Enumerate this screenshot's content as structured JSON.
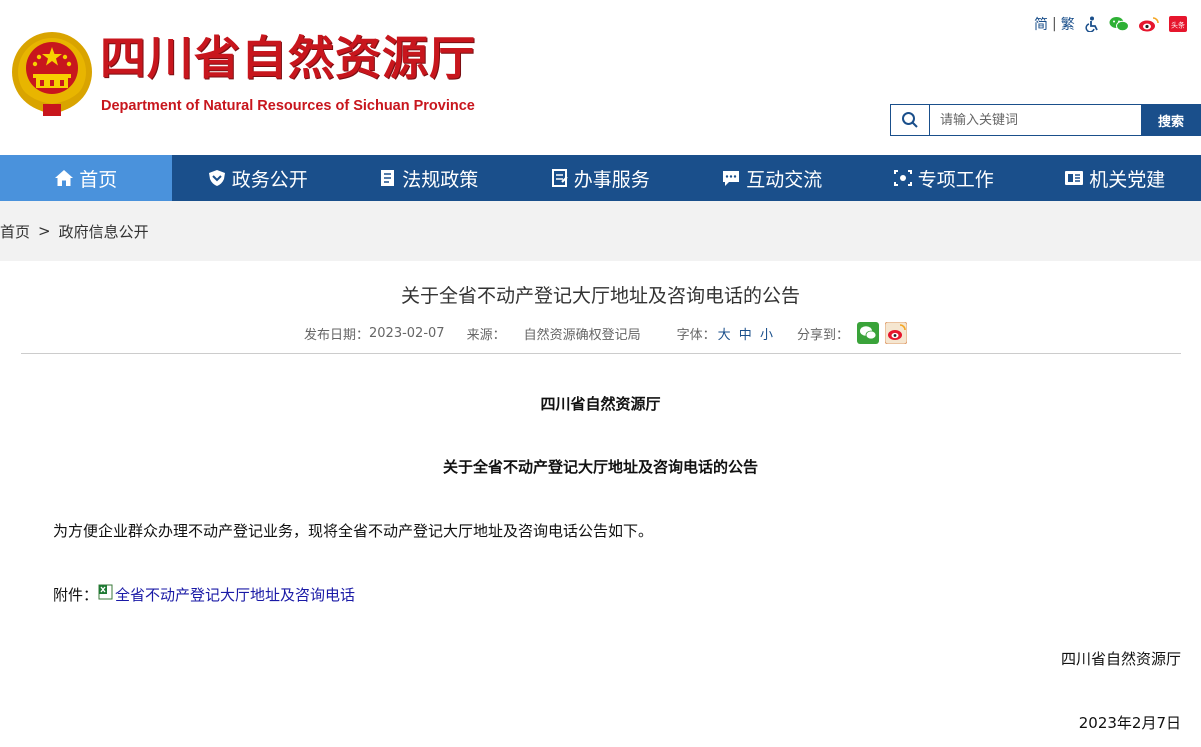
{
  "header": {
    "title": "四川省自然资源厅",
    "subtitle": "Department of Natural Resources of Sichuan Province",
    "emblem_icon": "national-emblem-icon"
  },
  "toplinks": {
    "simplified": "简",
    "traditional": "繁",
    "icons": [
      "accessibility-icon",
      "wechat-icon",
      "weibo-icon",
      "toutiao-icon"
    ],
    "toutiao_label": "头条"
  },
  "search": {
    "placeholder": "请输入关键词",
    "button_label": "搜索"
  },
  "nav": {
    "items": [
      {
        "label": "首页",
        "icon": "home-icon"
      },
      {
        "label": "政务公开",
        "icon": "shield-icon"
      },
      {
        "label": "法规政策",
        "icon": "document-icon"
      },
      {
        "label": "办事服务",
        "icon": "form-icon"
      },
      {
        "label": "互动交流",
        "icon": "chat-icon"
      },
      {
        "label": "专项工作",
        "icon": "target-icon"
      },
      {
        "label": "机关党建",
        "icon": "badge-icon"
      }
    ]
  },
  "breadcrumb": {
    "home": "首页",
    "separator": ">",
    "current": "政府信息公开"
  },
  "article": {
    "title": "关于全省不动产登记大厅地址及咨询电话的公告",
    "date_label": "发布日期：",
    "date": "2023-02-07",
    "source_label": "来源：",
    "source": "自然资源确权登记局",
    "font_label": "字体：",
    "font_large": "大",
    "font_medium": "中",
    "font_small": "小",
    "share_label": "分享到：",
    "org_heading": "四川省自然资源厅",
    "notice_heading": "关于全省不动产登记大厅地址及咨询电话的公告",
    "paragraph": "为方便企业群众办理不动产登记业务，现将全省不动产登记大厅地址及咨询电话公告如下。",
    "attachment_label": "附件：",
    "attachment_link": "全省不动产登记大厅地址及咨询电话",
    "sign_org": "四川省自然资源厅",
    "sign_date": "2023年2月7日"
  },
  "colors": {
    "brand_red": "#c8161d",
    "nav_blue": "#1a4f8b",
    "nav_active": "#4a92dc",
    "link_blue": "#1a1aa6"
  }
}
